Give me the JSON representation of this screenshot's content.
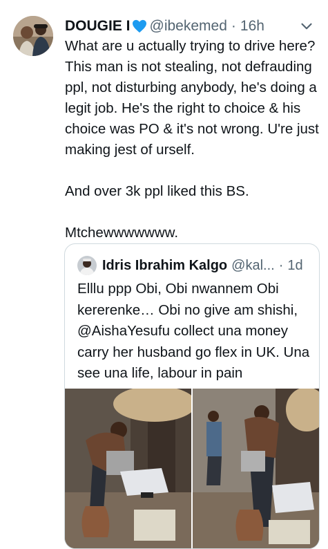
{
  "tweet": {
    "author_name": "DOUGIE I",
    "author_handle": "@ibekemed",
    "separator": "·",
    "time": "16h",
    "text": "What are u actually trying to drive here? This man is not stealing, not defrauding ppl, not disturbing anybody, he's doing a legit job. He's the right to choice & his choice was PO & it's not wrong. U're just making jest of urself.\n\nAnd over 3k ppl liked this BS.\n\nMtchewwwwwww.",
    "icons": {
      "name_emoji": "blue-heart-icon",
      "menu": "chevron-down-icon"
    }
  },
  "quoted_tweet": {
    "author_name": "Idris Ibrahim Kalgo",
    "author_handle": "@kal...",
    "separator": "·",
    "time": "1d",
    "text": "Elllu ppp Obi, Obi nwannem Obi kererenke… Obi no give am shishi, @AishaYesufu collect una money carry her husband go flex in UK. Una see una life, labour in pain",
    "media_count": 2
  },
  "colors": {
    "text_primary": "#0f1419",
    "text_secondary": "#536471",
    "border": "#cfd9de",
    "heart_blue": "#1d9bf0"
  }
}
